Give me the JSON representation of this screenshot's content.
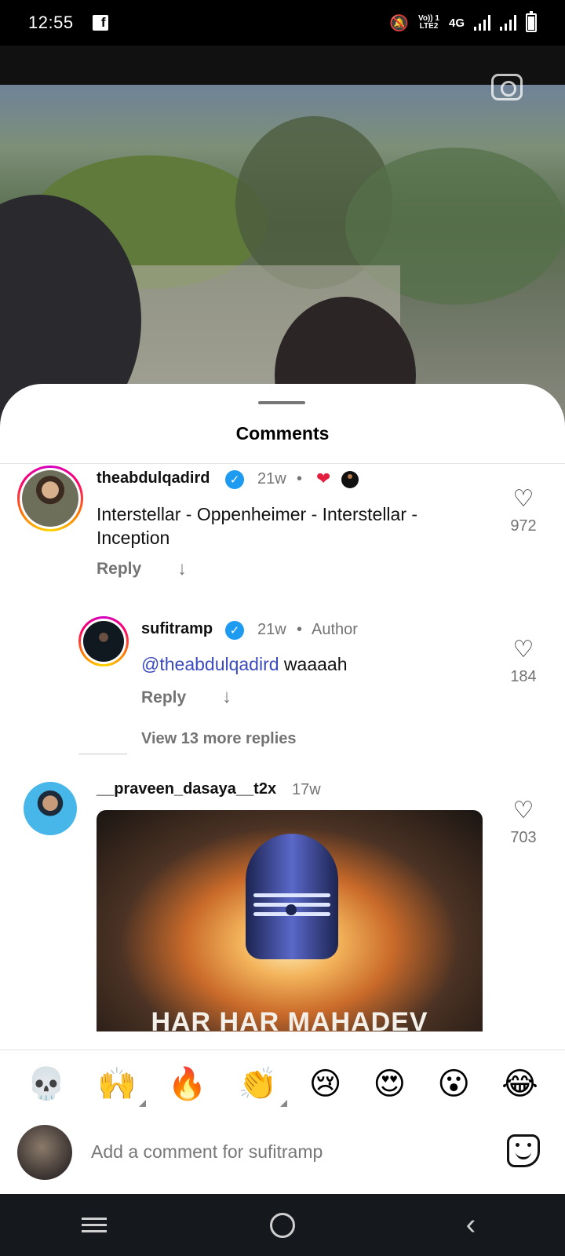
{
  "status_bar": {
    "time": "12:55",
    "app_badge": "f",
    "network_top": "Vo)) 1",
    "network_bottom": "LTE2",
    "network_type": "4G"
  },
  "sheet": {
    "title": "Comments"
  },
  "comments": [
    {
      "username": "theabdulqadird",
      "verified": true,
      "age": "21w",
      "separator": "•",
      "text": "Interstellar - Oppenheimer - Interstellar - Inception",
      "reply_label": "Reply",
      "likes": "972"
    },
    {
      "username": "sufitramp",
      "verified": true,
      "age": "21w",
      "badge": "Author",
      "mention": "@theabdulqadird",
      "text": " waaaah",
      "reply_label": "Reply",
      "likes": "184"
    },
    {
      "username": "__praveen_dasaya__t2x",
      "age": "17w",
      "gif_caption": "HAR HAR MAHADEV",
      "likes": "703"
    }
  ],
  "view_more_replies": "View 13 more replies",
  "emoji_bar": [
    "💀",
    "🙌",
    "🔥",
    "👏",
    "😢",
    "😍",
    "😮",
    "😂"
  ],
  "compose": {
    "placeholder": "Add a comment for sufitramp"
  }
}
